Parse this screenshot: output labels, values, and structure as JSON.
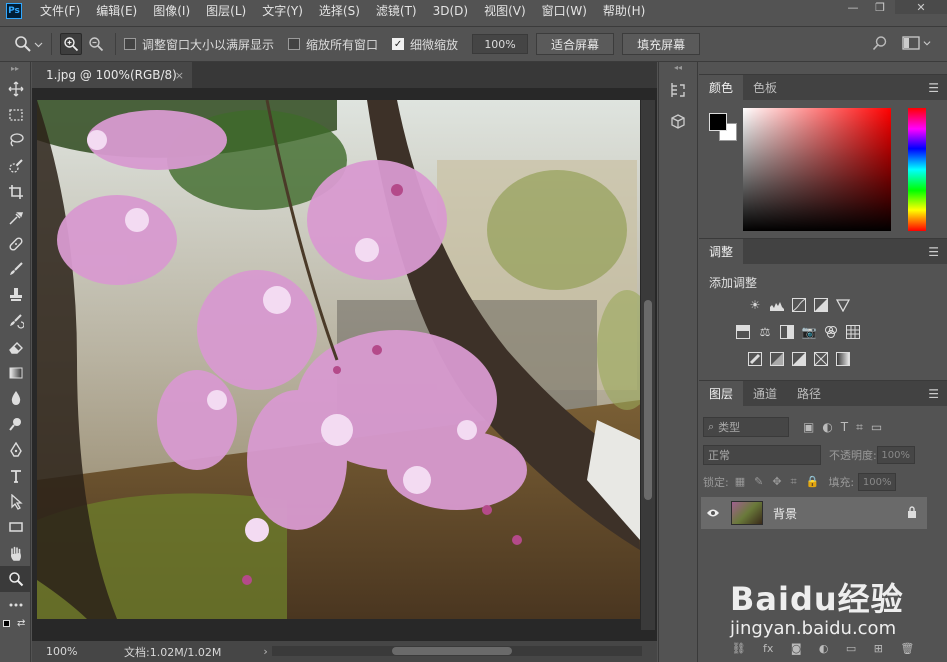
{
  "app": {
    "logo_text": "Ps"
  },
  "menu": [
    "文件(F)",
    "编辑(E)",
    "图像(I)",
    "图层(L)",
    "文字(Y)",
    "选择(S)",
    "滤镜(T)",
    "3D(D)",
    "视图(V)",
    "窗口(W)",
    "帮助(H)"
  ],
  "window_controls": {
    "minimize": "—",
    "restore": "❐",
    "close": "✕"
  },
  "options": {
    "resize_window": {
      "label": "调整窗口大小以满屏显示",
      "checked": false
    },
    "zoom_all": {
      "label": "缩放所有窗口",
      "checked": false
    },
    "scrubby_zoom": {
      "label": "细微缩放",
      "checked": true
    },
    "zoom_value": "100%",
    "fit_screen": "适合屏幕",
    "fill_screen": "填充屏幕"
  },
  "document": {
    "tab_title": "1.jpg @ 100%(RGB/8)",
    "tab_close": "×",
    "status_zoom": "100%",
    "status_doc": "文档:1.02M/1.02M",
    "status_arrow": "›"
  },
  "color_panel": {
    "tabs": [
      "颜色",
      "色板"
    ],
    "foreground": "#000000",
    "background": "#ffffff"
  },
  "adjust_panel": {
    "tab": "调整",
    "label": "添加调整"
  },
  "layers_panel": {
    "tabs": [
      "图层",
      "通道",
      "路径"
    ],
    "kind_filter": "类型",
    "blend_mode": "正常",
    "opacity_label": "不透明度:",
    "opacity_value": "100%",
    "lock_label": "锁定:",
    "fill_label": "填充:",
    "fill_value": "100%",
    "layers": [
      {
        "name": "背景",
        "visible": true,
        "locked": true
      }
    ],
    "footer_fx": "fx"
  },
  "watermark": {
    "logo": "Baidu经验",
    "url": "jingyan.baidu.com"
  },
  "colors": {
    "accent": "#31a8ff",
    "panel_bg": "#535353",
    "dark_bg": "#282828"
  }
}
